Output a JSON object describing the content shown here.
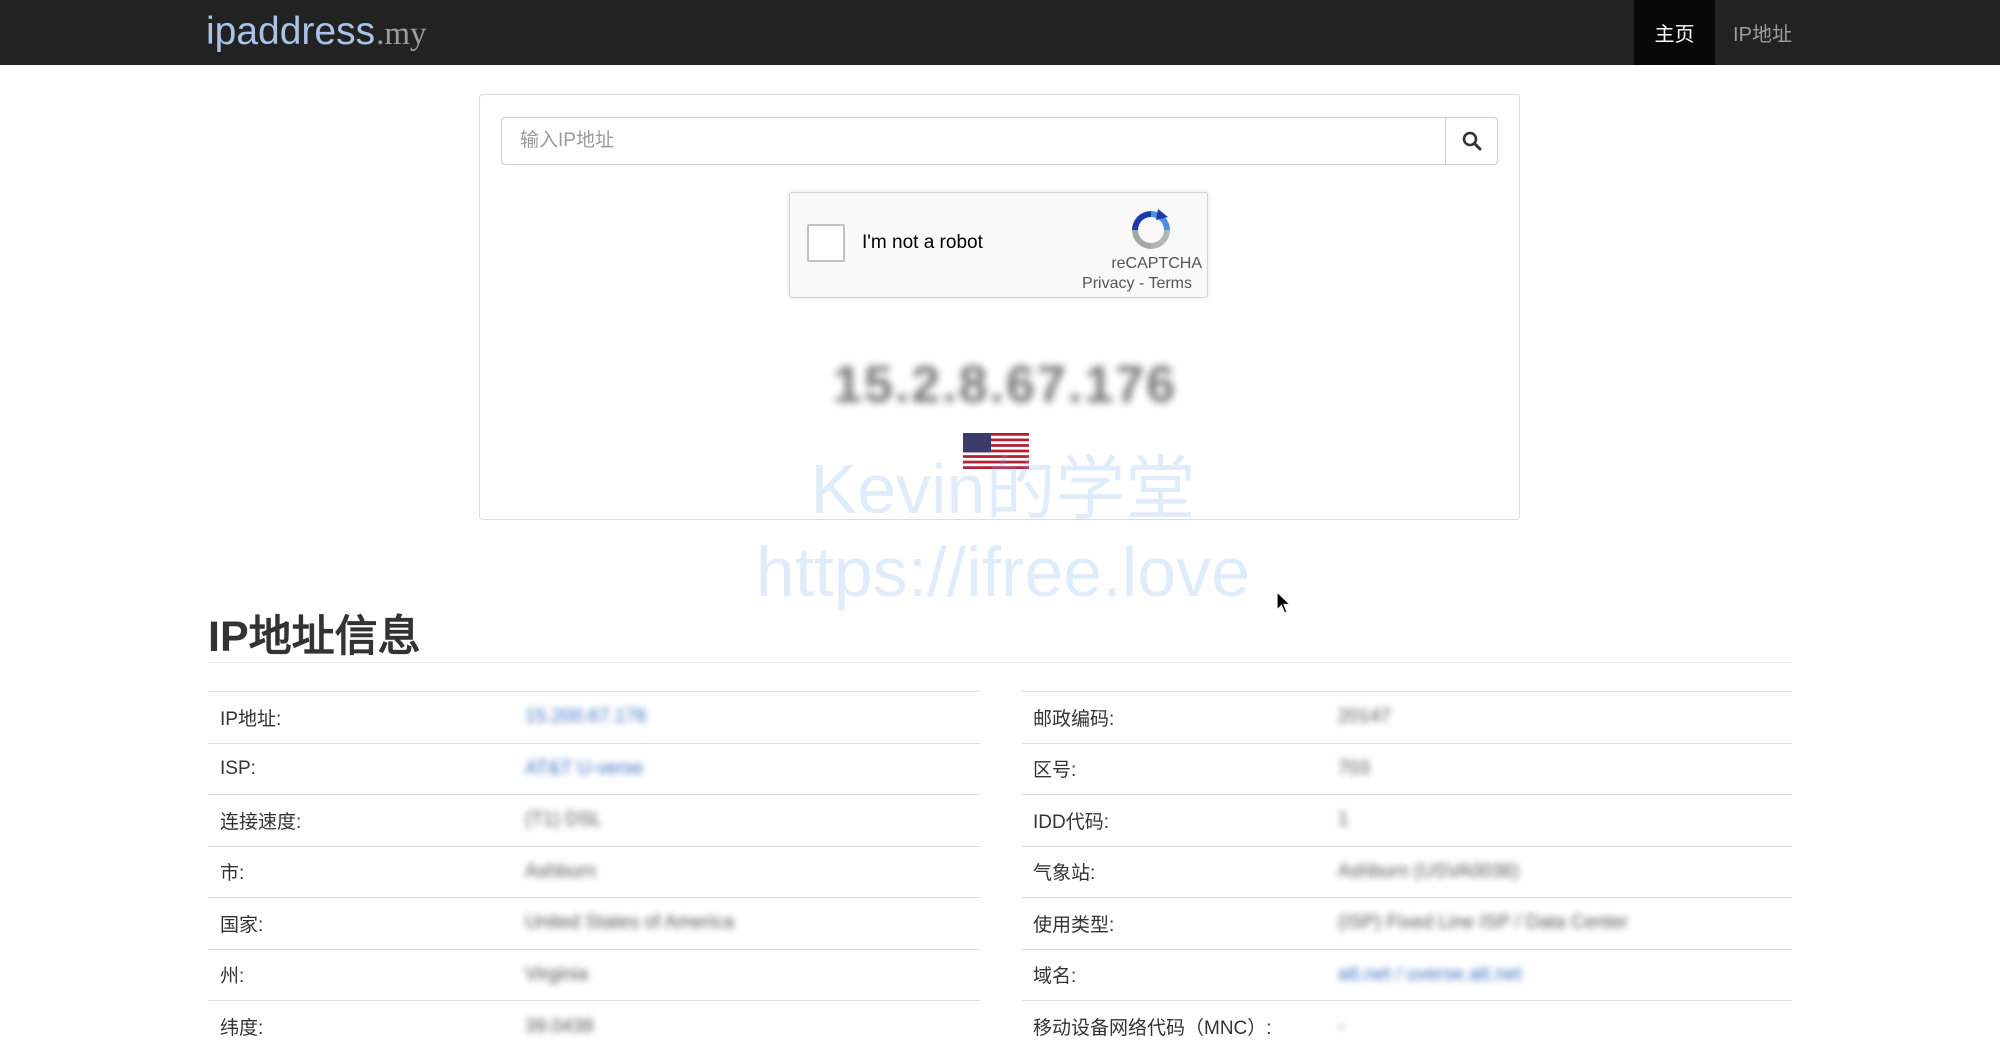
{
  "navbar": {
    "brand_main": "ipaddress",
    "brand_tld": ".my",
    "nav_home": "主页",
    "nav_ip": "IP地址"
  },
  "search": {
    "placeholder": "输入IP地址",
    "button_icon": "search-icon"
  },
  "recaptcha": {
    "label": "I'm not a robot",
    "brand": "reCAPTCHA",
    "privacy": "Privacy",
    "separator": " - ",
    "terms": "Terms"
  },
  "current_ip": "15.2.8.67.176",
  "flag": "us-flag",
  "watermark": {
    "line1": "Kevin的学堂",
    "line2": "https://ifree.love"
  },
  "section_title": "IP地址信息",
  "left_rows": [
    {
      "label": "IP地址:",
      "value": "15.200.67.176"
    },
    {
      "label": "ISP:",
      "value": "AT&T U-verse"
    },
    {
      "label": "连接速度:",
      "value": "(T1) DSL"
    },
    {
      "label": "市:",
      "value": "Ashburn"
    },
    {
      "label": "国家:",
      "value": "United States of America"
    },
    {
      "label": "州:",
      "value": "Virginia"
    },
    {
      "label": "纬度:",
      "value": "39.0438"
    }
  ],
  "right_rows": [
    {
      "label": "邮政编码:",
      "value": "20147"
    },
    {
      "label": "区号:",
      "value": "703"
    },
    {
      "label": "IDD代码:",
      "value": "1"
    },
    {
      "label": "气象站:",
      "value": "Ashburn (USVA0036)"
    },
    {
      "label": "使用类型:",
      "value": "(ISP) Fixed Line ISP / Data Center"
    },
    {
      "label": "域名:",
      "value": "att.net / uverse.att.net"
    },
    {
      "label": "移动设备网络代码（MNC）:",
      "value": "-"
    }
  ],
  "colors": {
    "navbar_bg": "#222222",
    "brand_blue": "#a9c2e6",
    "link_blue": "#3a6fc4"
  }
}
